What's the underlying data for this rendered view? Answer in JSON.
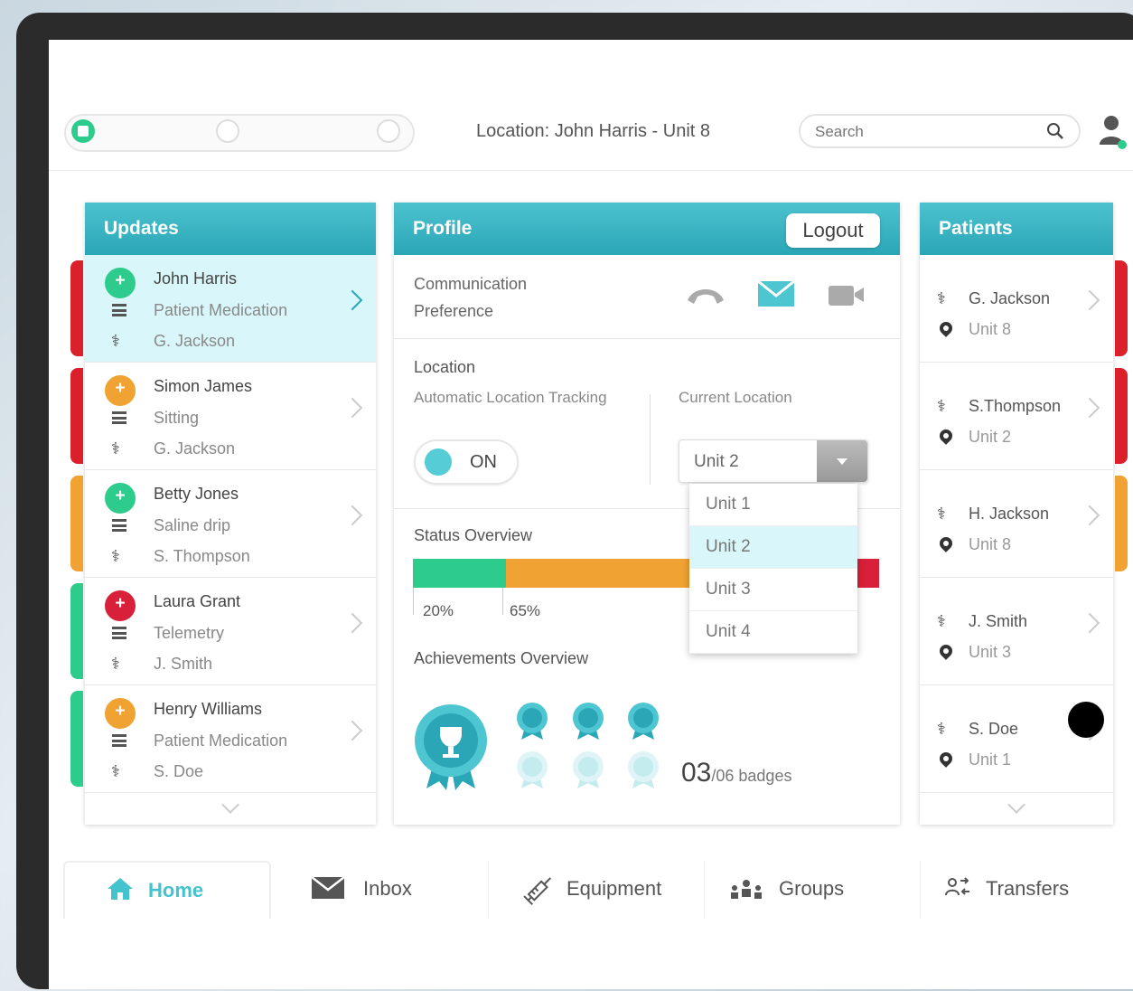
{
  "header": {
    "location_label": "Location: John Harris - Unit 8",
    "search_placeholder": "Search"
  },
  "updates": {
    "title": "Updates",
    "items": [
      {
        "name": "John Harris",
        "task": "Patient Medication",
        "doctor": "G. Jackson",
        "color": "#2ecc8c",
        "stripe": "#d9202b",
        "selected": true
      },
      {
        "name": "Simon James",
        "task": "Sitting",
        "doctor": "G. Jackson",
        "color": "#f0a232",
        "stripe": "#d9202b",
        "selected": false
      },
      {
        "name": "Betty Jones",
        "task": "Saline drip",
        "doctor": "S. Thompson",
        "color": "#2ecc8c",
        "stripe": "#f0a232",
        "selected": false
      },
      {
        "name": "Laura Grant",
        "task": "Telemetry",
        "doctor": "J. Smith",
        "color": "#d9203b",
        "stripe": "#2ecc8c",
        "selected": false
      },
      {
        "name": "Henry Williams",
        "task": "Patient Medication",
        "doctor": "S. Doe",
        "color": "#f0a232",
        "stripe": "#2ecc8c",
        "selected": false
      }
    ]
  },
  "profile": {
    "title": "Profile",
    "logout_label": "Logout",
    "comm_label_1": "Communication",
    "comm_label_2": "Preference",
    "location_heading": "Location",
    "auto_tracking_label": "Automatic Location Tracking",
    "current_location_label": "Current Location",
    "toggle_label": "ON",
    "selected_unit": "Unit 2",
    "unit_options": [
      "Unit 1",
      "Unit 2",
      "Unit 3",
      "Unit 4"
    ],
    "status_heading": "Status Overview",
    "status_pct_1": "20%",
    "status_pct_2": "65%",
    "status_segments": [
      {
        "fraction": 0.2,
        "color": "#2ecc8c"
      },
      {
        "fraction": 0.65,
        "color": "#f0a232"
      },
      {
        "fraction": 0.15,
        "color": "#d9203b"
      }
    ],
    "achievements_heading": "Achievements Overview",
    "badges_count": "03",
    "badges_total": "/06 badges"
  },
  "patients": {
    "title": "Patients",
    "items": [
      {
        "name": "G. Jackson",
        "unit": "Unit 8",
        "stripe": "#d9202b"
      },
      {
        "name": "S.Thompson",
        "unit": "Unit 2",
        "stripe": "#d9202b"
      },
      {
        "name": "H. Jackson",
        "unit": "Unit 8",
        "stripe": "#f0a232"
      },
      {
        "name": "J. Smith",
        "unit": "Unit 3",
        "stripe": "none"
      },
      {
        "name": "S. Doe",
        "unit": "Unit 1",
        "stripe": "none"
      }
    ]
  },
  "nav": {
    "home": "Home",
    "inbox": "Inbox",
    "equipment": "Equipment",
    "groups": "Groups",
    "transfers": "Transfers"
  },
  "colors": {
    "accent": "#2aa6b6",
    "green": "#2ecc8c",
    "orange": "#f0a232",
    "red": "#d9203b"
  }
}
